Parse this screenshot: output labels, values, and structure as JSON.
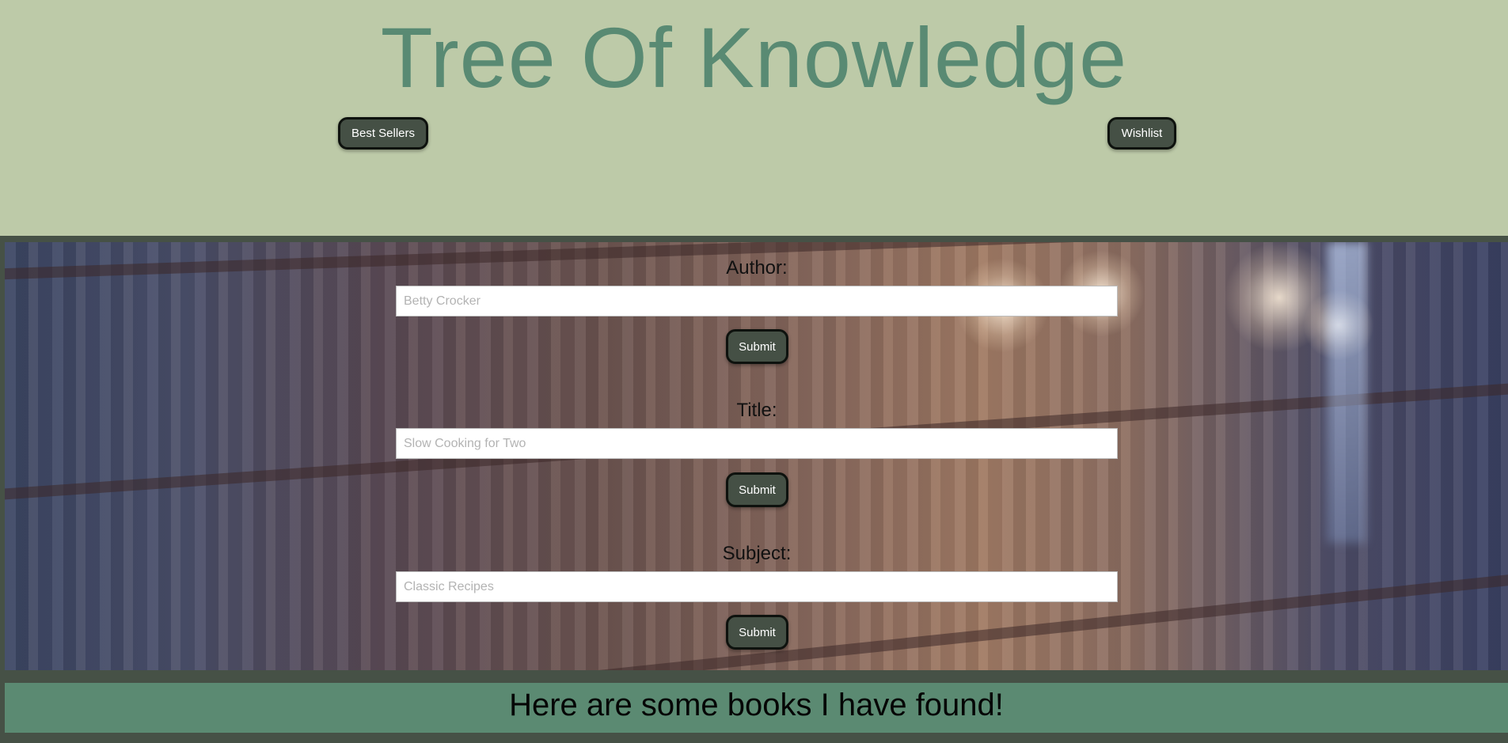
{
  "header": {
    "title": "Tree Of Knowledge",
    "nav": {
      "best_sellers": "Best Sellers",
      "wishlist": "Wishlist"
    }
  },
  "search": {
    "author": {
      "label": "Author:",
      "placeholder": "Betty Crocker",
      "submit": "Submit"
    },
    "title": {
      "label": "Title:",
      "placeholder": "Slow Cooking for Two",
      "submit": "Submit"
    },
    "subject": {
      "label": "Subject:",
      "placeholder": "Classic Recipes",
      "submit": "Submit"
    }
  },
  "results": {
    "heading": "Here are some books I have found!"
  },
  "colors": {
    "header_bg": "#bdcaa8",
    "title_green": "#598a73",
    "button_bg": "#455045",
    "page_bg": "#465146",
    "results_bg": "#5b8a72"
  }
}
